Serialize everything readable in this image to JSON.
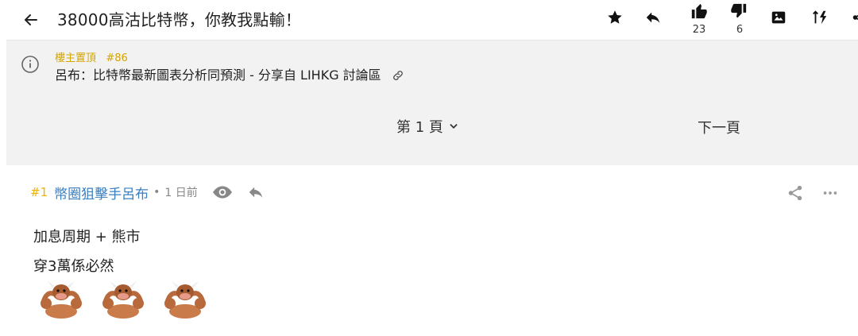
{
  "header": {
    "title": "38000高沽比特幣，你教我點輸！",
    "like_count": "23",
    "dislike_count": "6"
  },
  "pinned": {
    "label": "樓主置頂   #86",
    "text": "呂布：比特幣最新圖表分析同預測 - 分享自 LIHKG 討論區"
  },
  "pagination": {
    "current_page": "第 1 頁",
    "next_label": "下一頁"
  },
  "post": {
    "number": "#1",
    "author": "幣圈狙擊手呂布",
    "separator": "•",
    "time": "1 日前",
    "lines": [
      "加息周期 + 熊市",
      "穿3萬係必然"
    ],
    "emojis": [
      "bull-emoji",
      "bull-emoji",
      "bull-emoji"
    ]
  },
  "colors": {
    "accent_yellow": "#f0b400",
    "author_blue": "#3a7fc1",
    "pinned_bg": "#f2f2f2"
  },
  "icons": [
    "back-arrow-icon",
    "star-icon",
    "reply-icon",
    "thumbs-up-icon",
    "thumbs-down-icon",
    "image-icon",
    "sort-icon",
    "share-icon",
    "info-icon",
    "link-icon",
    "chevron-down-icon",
    "eye-icon",
    "more-icon"
  ]
}
